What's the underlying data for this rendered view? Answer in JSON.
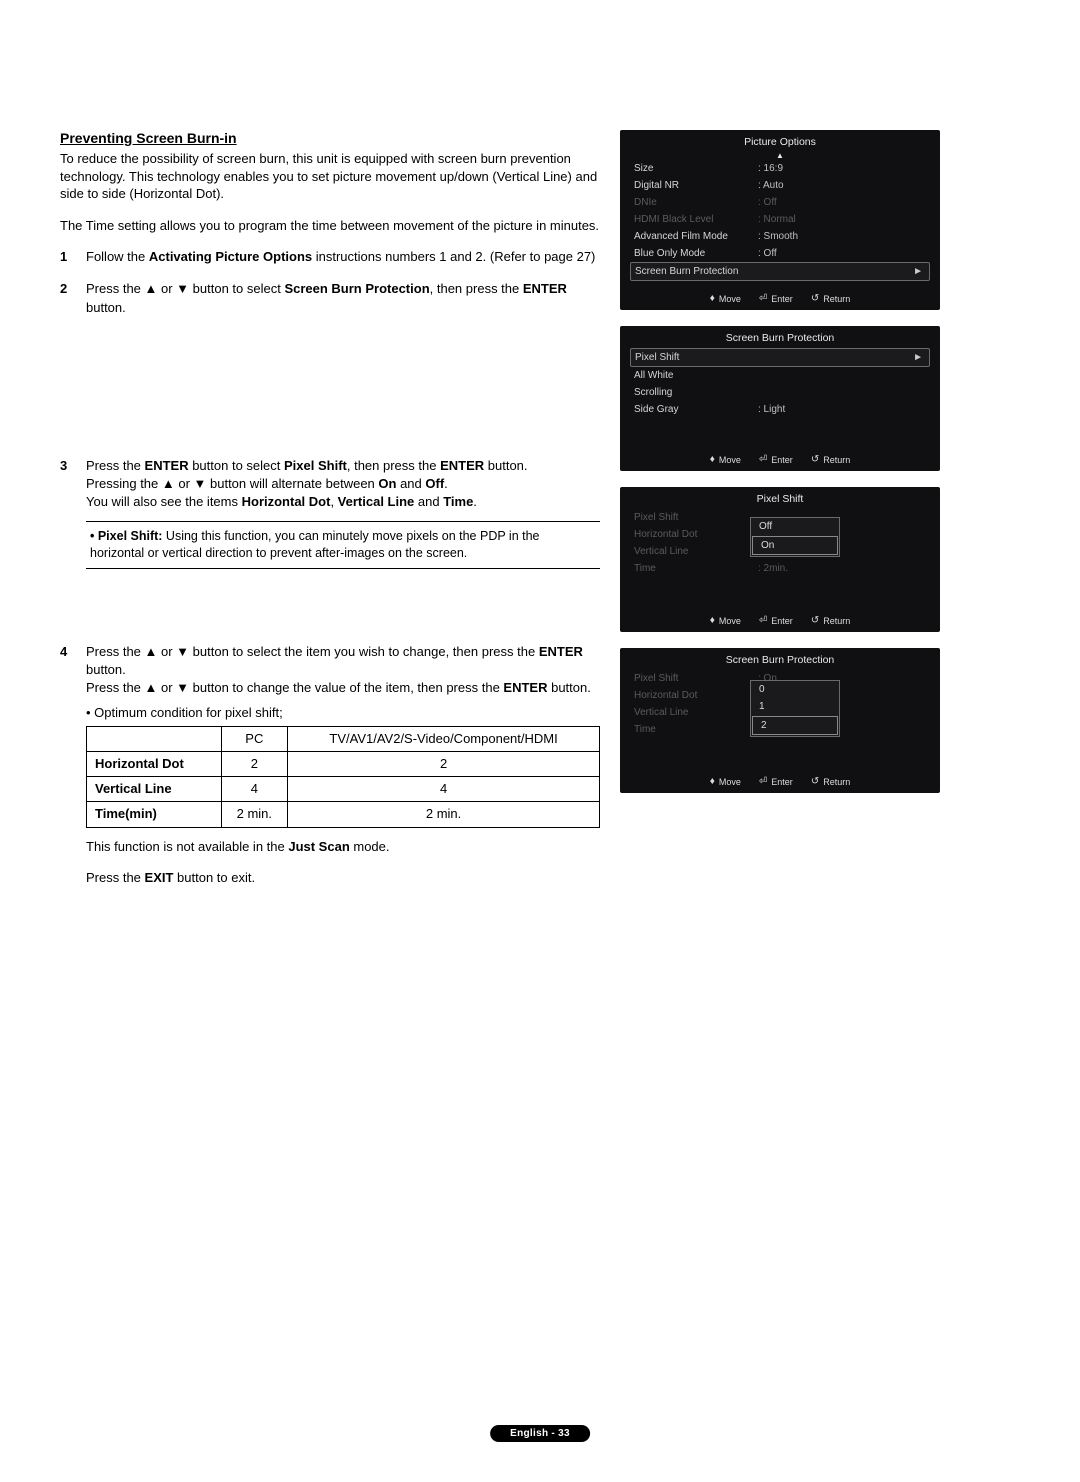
{
  "title": "Preventing Screen Burn-in",
  "intro1": "To reduce the possibility of screen burn, this unit is equipped with screen burn prevention technology. This technology enables you to set picture movement up/down (Vertical Line) and side to side (Horizontal Dot).",
  "intro2": "The Time setting allows you to program the time between movement of the picture in minutes.",
  "steps": {
    "s1a": "Follow the ",
    "s1b": "Activating Picture Options",
    "s1c": " instructions numbers 1 and 2. (Refer to page 27)",
    "s2a": "Press the ▲ or ▼ button to select ",
    "s2b": "Screen Burn Protection",
    "s2c": ", then press the ",
    "s2d": "ENTER",
    "s2e": " button.",
    "s3a": "Press the ",
    "s3b": "ENTER",
    "s3c": " button to select ",
    "s3d": "Pixel Shift",
    "s3e": ", then press the ",
    "s3f": "ENTER",
    "s3g": " button.",
    "s3h": "Pressing the ▲ or ▼ button will alternate between ",
    "s3i": "On",
    "s3j": " and ",
    "s3k": "Off",
    "s3l": ".",
    "s3m": "You will also see the items ",
    "s3n": "Horizontal Dot",
    "s3o": ", ",
    "s3p": "Vertical Line",
    "s3q": " and ",
    "s3r": "Time",
    "s3s": ".",
    "s4a": "Press the ▲ or ▼ button to select the item you wish to change, then press the ",
    "s4b": "ENTER",
    "s4c": " button.",
    "s4d": "Press the ▲ or ▼ button to change the value of the item, then press the ",
    "s4e": "ENTER",
    "s4f": " button."
  },
  "note_label": "• Pixel Shift:",
  "note_text": " Using this function, you can minutely move pixels on the PDP in the horizontal or vertical direction to prevent after-images on the screen.",
  "opt_label": "• Optimum condition for pixel shift;",
  "opt_table": {
    "headers": [
      "",
      "PC",
      "TV/AV1/AV2/S-Video/Component/HDMI"
    ],
    "rows": [
      [
        "Horizontal Dot",
        "2",
        "2"
      ],
      [
        "Vertical Line",
        "4",
        "4"
      ],
      [
        "Time(min)",
        "2 min.",
        "2 min."
      ]
    ]
  },
  "note2a": "This function is not available in the ",
  "note2b": "Just Scan",
  "note2c": " mode.",
  "exit_a": "Press the ",
  "exit_b": "EXIT",
  "exit_c": " button to exit.",
  "chart_data": {
    "type": "table",
    "title": "Optimum condition for pixel shift",
    "categories": [
      "PC",
      "TV/AV1/AV2/S-Video/Component/HDMI"
    ],
    "series": [
      {
        "name": "Horizontal Dot",
        "values": [
          2,
          2
        ]
      },
      {
        "name": "Vertical Line",
        "values": [
          4,
          4
        ]
      },
      {
        "name": "Time(min)",
        "values": [
          "2 min.",
          "2 min."
        ]
      }
    ]
  },
  "osd1": {
    "title": "Picture Options",
    "rows": [
      {
        "label": "Size",
        "value": ": 16:9"
      },
      {
        "label": "Digital NR",
        "value": ": Auto"
      },
      {
        "label": "DNIe",
        "value": ": Off",
        "dim": true
      },
      {
        "label": "HDMI Black Level",
        "value": ": Normal",
        "dim": true
      },
      {
        "label": "Advanced Film Mode",
        "value": ": Smooth"
      },
      {
        "label": "Blue Only Mode",
        "value": ": Off"
      },
      {
        "label": "Screen Burn Protection",
        "value": "",
        "sel": true
      }
    ]
  },
  "osd2": {
    "title": "Screen Burn Protection",
    "rows": [
      {
        "label": "Pixel Shift",
        "value": "",
        "sel": true
      },
      {
        "label": "All White",
        "value": ""
      },
      {
        "label": "Scrolling",
        "value": ""
      },
      {
        "label": "Side Gray",
        "value": ": Light"
      }
    ]
  },
  "osd3": {
    "title": "Pixel Shift",
    "rows": [
      {
        "label": "Pixel Shift",
        "value": "",
        "dim": true
      },
      {
        "label": "Horizontal Dot",
        "value": "",
        "dim": true
      },
      {
        "label": "Vertical Line",
        "value": "",
        "dim": true
      },
      {
        "label": "Time",
        "value": ": 2min.",
        "dim": true
      }
    ],
    "popup": [
      "Off",
      "On"
    ],
    "popup_sel": 1
  },
  "osd4": {
    "title": "Screen Burn Protection",
    "rows": [
      {
        "label": "Pixel Shift",
        "value": ": On",
        "dim": true
      },
      {
        "label": "Horizontal Dot",
        "value": "",
        "dim": true
      },
      {
        "label": "Vertical Line",
        "value": "",
        "dim": true
      },
      {
        "label": "Time",
        "value": "",
        "dim": true
      }
    ],
    "popup": [
      "0",
      "1",
      "2"
    ],
    "popup_sel": 2
  },
  "footer": {
    "move": "Move",
    "enter": "Enter",
    "return": "Return"
  },
  "page_footer": "English - 33"
}
